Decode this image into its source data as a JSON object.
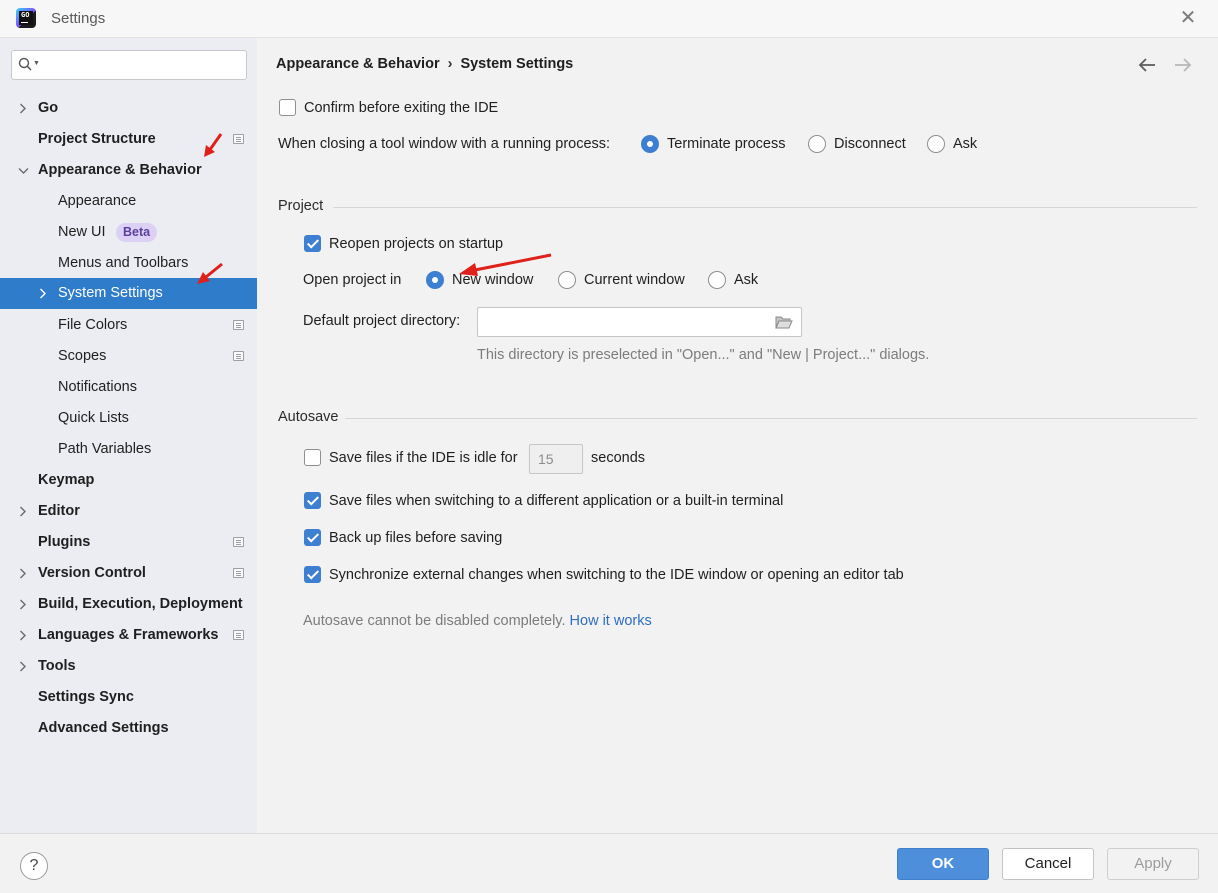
{
  "window": {
    "title": "Settings"
  },
  "search": {
    "placeholder": ""
  },
  "sidebar": {
    "items": [
      {
        "label": "Go"
      },
      {
        "label": "Project Structure"
      },
      {
        "label": "Appearance & Behavior"
      },
      {
        "label": "Appearance"
      },
      {
        "label": "New UI",
        "badge": "Beta"
      },
      {
        "label": "Menus and Toolbars"
      },
      {
        "label": "System Settings"
      },
      {
        "label": "File Colors"
      },
      {
        "label": "Scopes"
      },
      {
        "label": "Notifications"
      },
      {
        "label": "Quick Lists"
      },
      {
        "label": "Path Variables"
      },
      {
        "label": "Keymap"
      },
      {
        "label": "Editor"
      },
      {
        "label": "Plugins"
      },
      {
        "label": "Version Control"
      },
      {
        "label": "Build, Execution, Deployment"
      },
      {
        "label": "Languages & Frameworks"
      },
      {
        "label": "Tools"
      },
      {
        "label": "Settings Sync"
      },
      {
        "label": "Advanced Settings"
      }
    ],
    "selected_color": "#2f7cca"
  },
  "breadcrumb": {
    "parent": "Appearance & Behavior",
    "current": "System Settings"
  },
  "general": {
    "confirm_exit": {
      "label": "Confirm before exiting the IDE",
      "checked": false
    },
    "closing_label": "When closing a tool window with a running process:",
    "closing_options": [
      {
        "label": "Terminate process",
        "selected": true
      },
      {
        "label": "Disconnect",
        "selected": false
      },
      {
        "label": "Ask",
        "selected": false
      }
    ]
  },
  "project": {
    "title": "Project",
    "reopen": {
      "label": "Reopen projects on startup",
      "checked": true
    },
    "open_in_label": "Open project in",
    "open_in_options": [
      {
        "label": "New window",
        "selected": true
      },
      {
        "label": "Current window",
        "selected": false
      },
      {
        "label": "Ask",
        "selected": false
      }
    ],
    "default_dir_label": "Default project directory:",
    "default_dir_value": "",
    "default_dir_hint": "This directory is preselected in \"Open...\" and \"New | Project...\" dialogs."
  },
  "autosave": {
    "title": "Autosave",
    "idle": {
      "label": "Save files if the IDE is idle for",
      "checked": false,
      "value": "15",
      "unit": "seconds"
    },
    "switching": {
      "label": "Save files when switching to a different application or a built-in terminal",
      "checked": true
    },
    "backup": {
      "label": "Back up files before saving",
      "checked": true
    },
    "sync": {
      "label": "Synchronize external changes when switching to the IDE window or opening an editor tab",
      "checked": true
    },
    "note": "Autosave cannot be disabled completely.",
    "note_link": "How it works"
  },
  "footer": {
    "help": "?",
    "ok": "OK",
    "cancel": "Cancel",
    "apply": "Apply"
  },
  "colors": {
    "accent": "#3d7fd0",
    "annotation_arrow": "#e0201b"
  }
}
